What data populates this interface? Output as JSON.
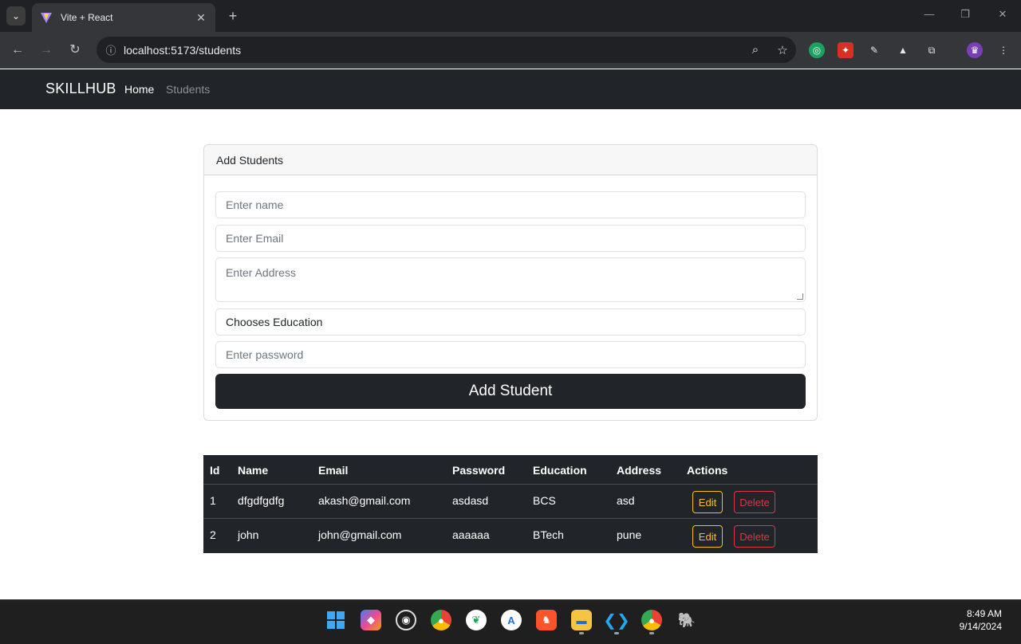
{
  "browser": {
    "tab_title": "Vite + React",
    "tab_close": "✕",
    "new_tab": "+",
    "url": "localhost:5173/students",
    "window_controls": [
      "—",
      "❐",
      "✕"
    ]
  },
  "navbar": {
    "brand": "SKILLHUB",
    "links": [
      "Home",
      "Students"
    ]
  },
  "form": {
    "header": "Add Students",
    "name_placeholder": "Enter name",
    "email_placeholder": "Enter Email",
    "address_placeholder": "Enter Address",
    "education_selected": "Chooses Education",
    "password_placeholder": "Enter password",
    "submit_label": "Add Student"
  },
  "table": {
    "headers": [
      "Id",
      "Name",
      "Email",
      "Password",
      "Education",
      "Address",
      "Actions"
    ],
    "rows": [
      {
        "id": "1",
        "name": "dfgdfgdfg",
        "email": "akash@gmail.com",
        "password": "asdasd",
        "education": "BCS",
        "address": "asd",
        "edit": "Edit",
        "delete": "Delete"
      },
      {
        "id": "2",
        "name": "john",
        "email": "john@gmail.com",
        "password": "aaaaaa",
        "education": "BTech",
        "address": "pune",
        "edit": "Edit",
        "delete": "Delete"
      }
    ]
  },
  "taskbar": {
    "time": "8:49 AM",
    "date": "9/14/2024",
    "apps": [
      "windows-start",
      "copilot",
      "obs",
      "chrome",
      "mongodb-compass",
      "app-store",
      "brave",
      "file-explorer",
      "vscode",
      "chrome-profile",
      "postgresql"
    ]
  },
  "colors": {
    "navbar_bg": "#212529",
    "edit_outline": "#ffc107",
    "delete_outline": "#dc3545"
  }
}
